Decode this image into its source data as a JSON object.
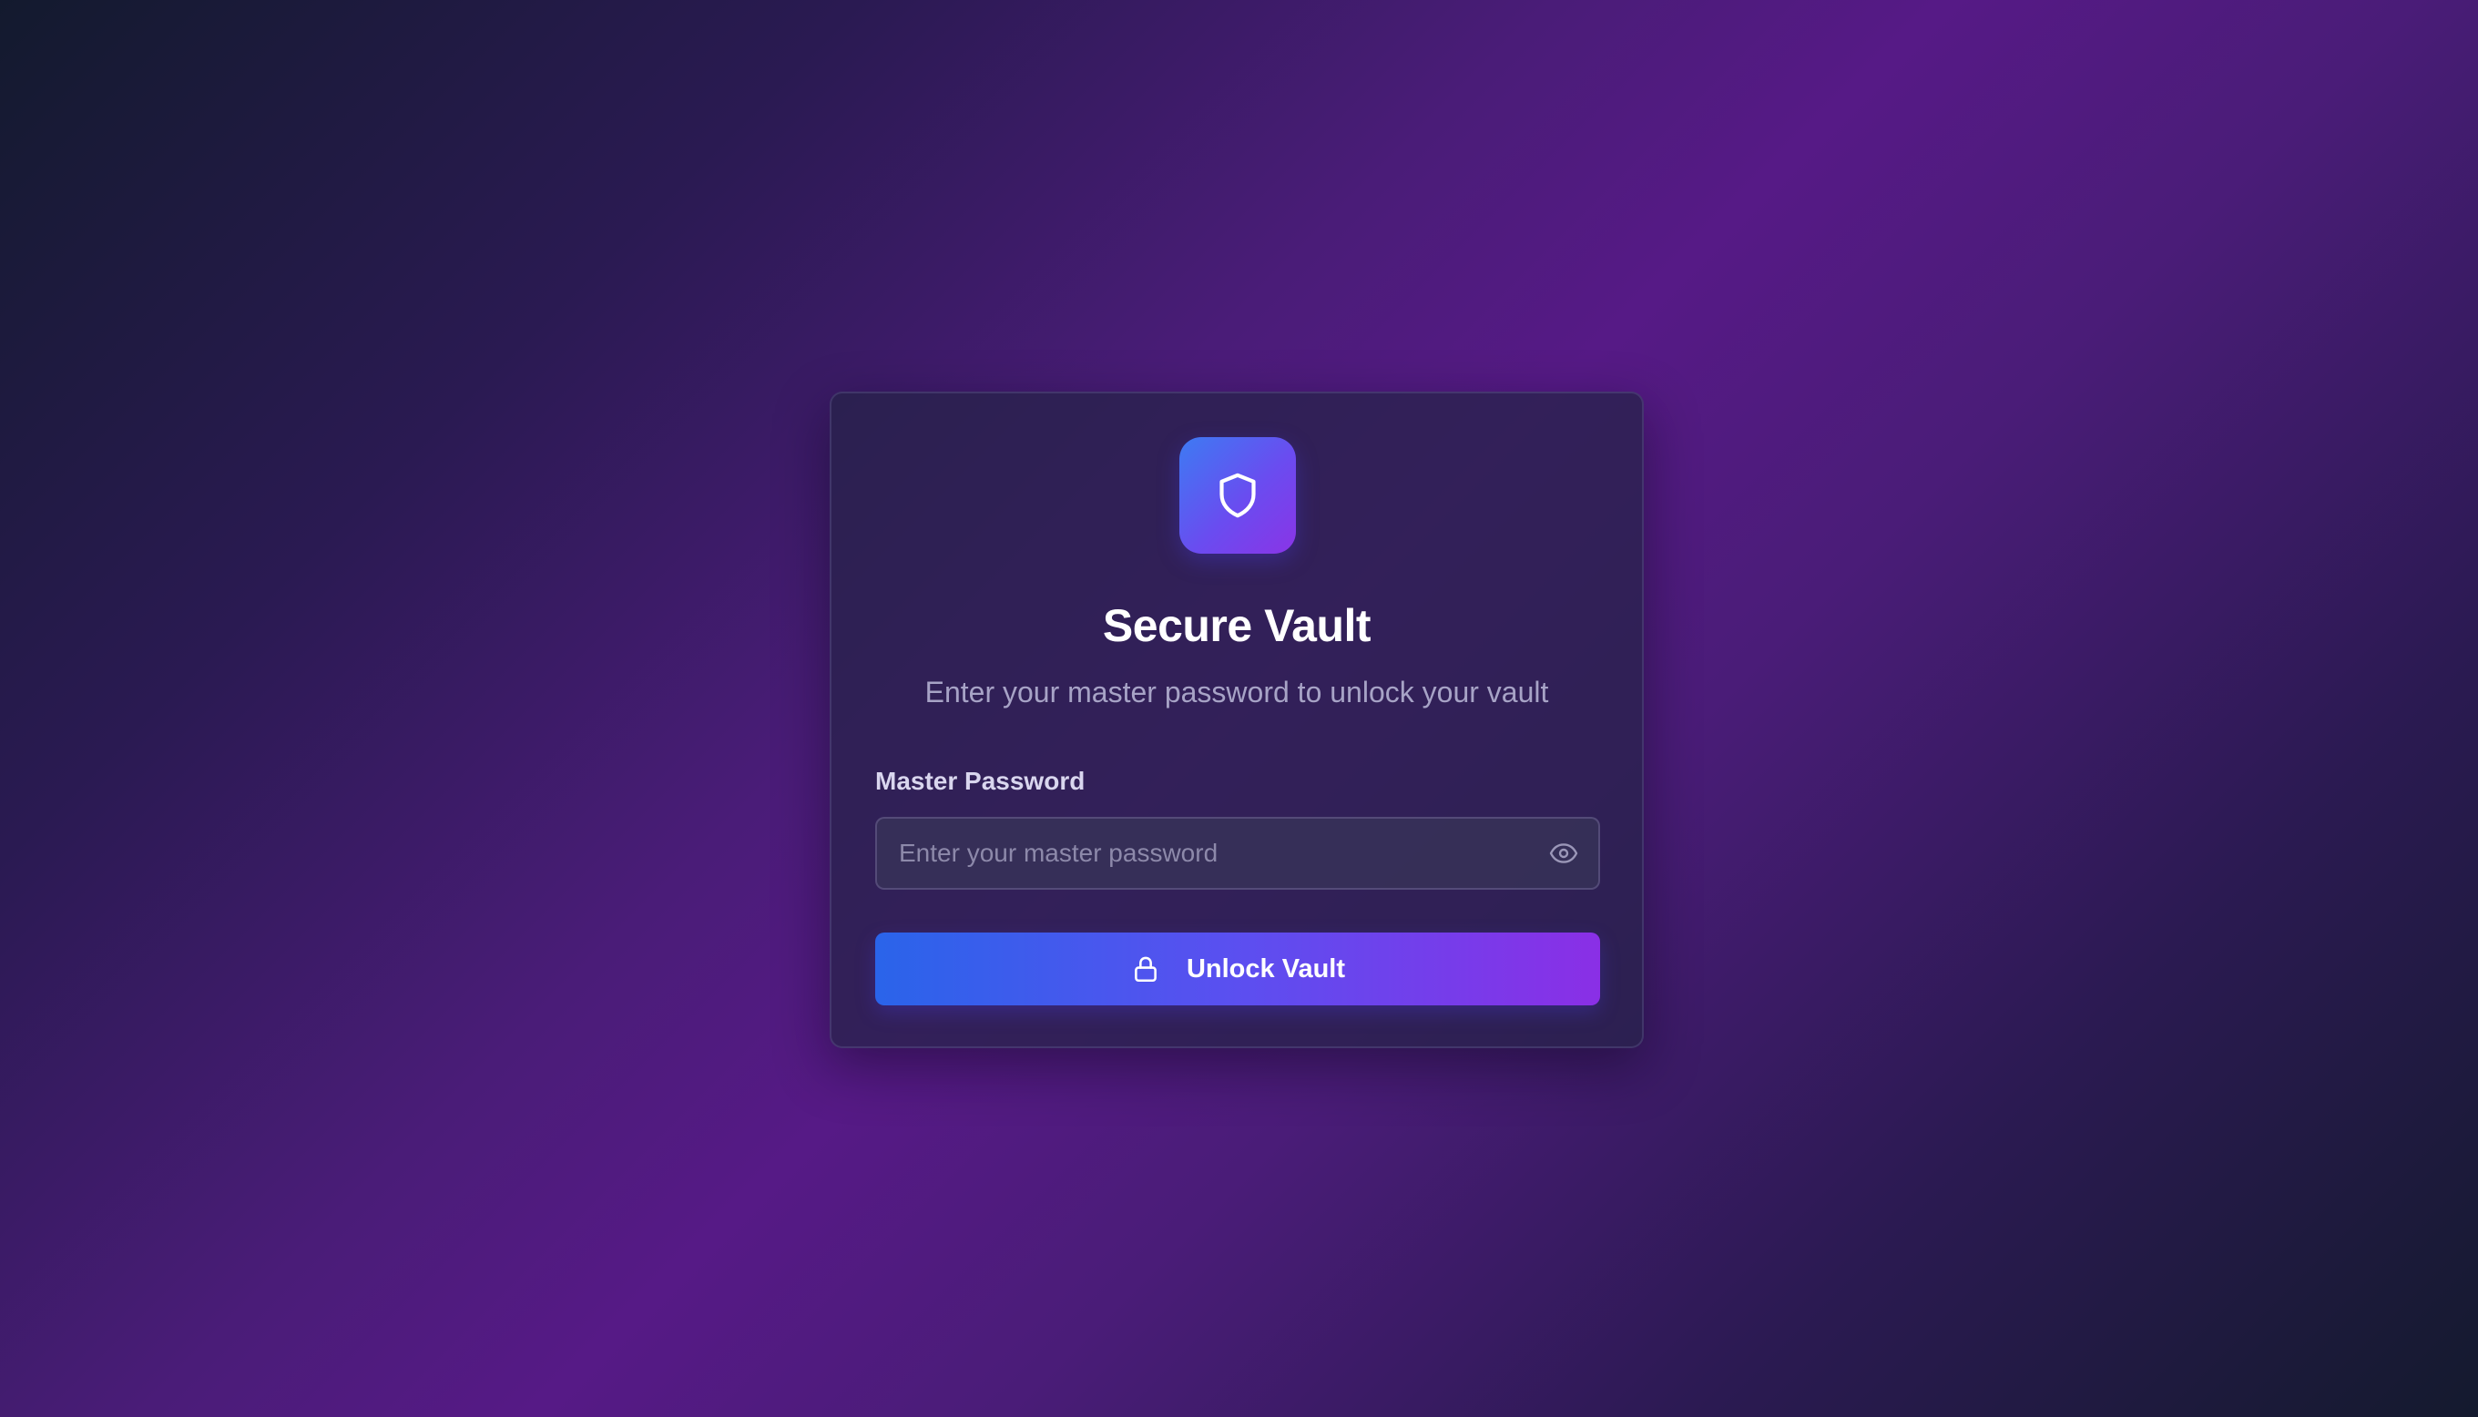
{
  "app": {
    "title": "Secure Vault",
    "subtitle": "Enter your master password to unlock your vault"
  },
  "form": {
    "password_label": "Master Password",
    "password_placeholder": "Enter your master password",
    "password_value": "",
    "show_password_icon": "eye-icon",
    "submit_label": "Unlock Vault",
    "submit_icon": "lock-icon"
  },
  "icons": {
    "logo": "shield-icon"
  },
  "colors": {
    "accent_start": "#2a64ea",
    "accent_end": "#8a2fe6",
    "card_bg": "#262248",
    "text_primary": "#ffffff",
    "text_muted": "#a7a3c6"
  }
}
